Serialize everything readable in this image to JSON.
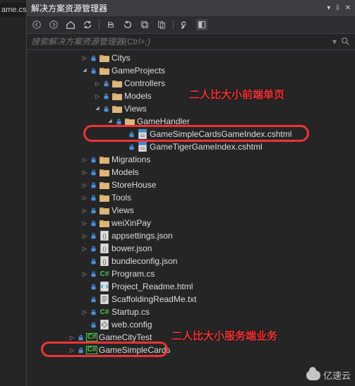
{
  "left_tab": "ame.cs",
  "panel": {
    "title": "解决方案资源管理器",
    "search_placeholder": "搜索解决方案资源管理器(Ctrl+;)"
  },
  "annotations": {
    "top": "二人比大小前端单页",
    "bottom": "二人比大小服务端业务"
  },
  "watermark": "亿速云",
  "tree": [
    {
      "depth": 2,
      "arrow": "collapsed",
      "lock": true,
      "icon": "folder",
      "label": "Citys"
    },
    {
      "depth": 2,
      "arrow": "expanded",
      "lock": true,
      "icon": "folder",
      "label": "GameProjects"
    },
    {
      "depth": 3,
      "arrow": "collapsed",
      "lock": true,
      "icon": "folder",
      "label": "Controllers"
    },
    {
      "depth": 3,
      "arrow": "collapsed",
      "lock": true,
      "icon": "folder",
      "label": "Models"
    },
    {
      "depth": 3,
      "arrow": "expanded",
      "lock": true,
      "icon": "folder",
      "label": "Views"
    },
    {
      "depth": 4,
      "arrow": "expanded",
      "lock": true,
      "icon": "folder",
      "label": "GameHandler"
    },
    {
      "depth": 5,
      "arrow": "none",
      "lock": true,
      "icon": "cshtml",
      "label": "GameSimpleCardsGameIndex.cshtml",
      "ring": "ring1"
    },
    {
      "depth": 5,
      "arrow": "none",
      "lock": true,
      "icon": "cshtml",
      "label": "GameTigerGameIndex.cshtml"
    },
    {
      "depth": 2,
      "arrow": "collapsed",
      "lock": true,
      "icon": "folder",
      "label": "Migrations"
    },
    {
      "depth": 2,
      "arrow": "collapsed",
      "lock": true,
      "icon": "folder",
      "label": "Models"
    },
    {
      "depth": 2,
      "arrow": "collapsed",
      "lock": true,
      "icon": "folder",
      "label": "StoreHouse"
    },
    {
      "depth": 2,
      "arrow": "collapsed",
      "lock": true,
      "icon": "folder",
      "label": "Tools"
    },
    {
      "depth": 2,
      "arrow": "collapsed",
      "lock": true,
      "icon": "folder",
      "label": "Views"
    },
    {
      "depth": 2,
      "arrow": "collapsed",
      "lock": true,
      "icon": "folder",
      "label": "weiXinPay"
    },
    {
      "depth": 2,
      "arrow": "collapsed",
      "lock": true,
      "icon": "json",
      "label": "appsettings.json"
    },
    {
      "depth": 2,
      "arrow": "collapsed",
      "lock": true,
      "icon": "json",
      "label": "bower.json"
    },
    {
      "depth": 2,
      "arrow": "none",
      "lock": true,
      "icon": "json",
      "label": "bundleconfig.json"
    },
    {
      "depth": 2,
      "arrow": "collapsed",
      "lock": true,
      "icon": "cs",
      "label": "Program.cs"
    },
    {
      "depth": 2,
      "arrow": "none",
      "lock": true,
      "icon": "html",
      "label": "Project_Readme.html"
    },
    {
      "depth": 2,
      "arrow": "none",
      "lock": true,
      "icon": "txt",
      "label": "ScaffoldingReadMe.txt"
    },
    {
      "depth": 2,
      "arrow": "collapsed",
      "lock": true,
      "icon": "cs",
      "label": "Startup.cs"
    },
    {
      "depth": 2,
      "arrow": "none",
      "lock": true,
      "icon": "config",
      "label": "web.config"
    },
    {
      "depth": 1,
      "arrow": "collapsed",
      "lock": true,
      "icon": "csproj",
      "label": "GameCityTest"
    },
    {
      "depth": 1,
      "arrow": "collapsed",
      "lock": true,
      "icon": "csproj",
      "label": "GameSimpleCards",
      "ring": "ring2"
    }
  ]
}
